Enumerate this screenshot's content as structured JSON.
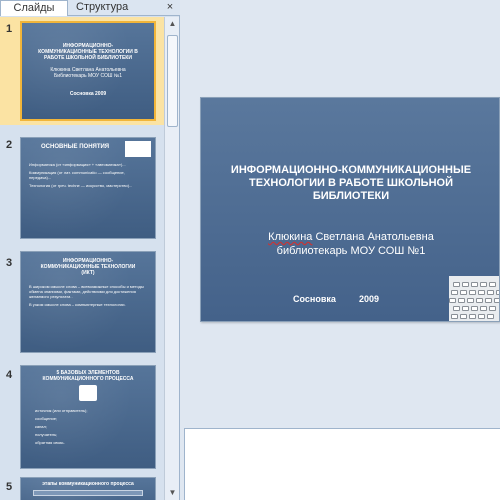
{
  "left_pane": {
    "tabs": {
      "slides": "Слайды",
      "outline": "Структура"
    },
    "close_symbol": "×",
    "thumbnails": [
      {
        "number": "1",
        "title": "ИНФОРМАЦИОННО-КОММУНИКАЦИОННЫЕ ТЕХНОЛОГИИ В РАБОТЕ ШКОЛЬНОЙ БИБЛИОТЕКИ",
        "subtitle": "Клюкина Светлана Анатольевна Библиотекарь МОУ СОШ №1",
        "footer": "Сосновка 2009"
      },
      {
        "number": "2",
        "title": "ОСНОВНЫЕ ПОНЯТИЯ",
        "bullets": [
          "Информатика (от «информация» + «автоматика»)...",
          "Коммуникация (от лат. communicatio — сообщение, передача)...",
          "Технология (от греч. techne — искусство, мастерство)..."
        ]
      },
      {
        "number": "3",
        "title": "ИНФОРМАЦИОННО-КОММУНИКАЦИОННЫЕ ТЕХНОЛОГИИ (ИКТ)",
        "bullets": [
          "В широком смысле слова – всевозможные способы и методы обмена знаниями, фактами, действиями для достижения желаемого результата .",
          "В узком смысле слова – компьютерные технологии."
        ]
      },
      {
        "number": "4",
        "title": "5 БАЗОВЫХ ЭЛЕМЕНТОВ КОММУНИКАЦИОННОГО ПРОЦЕССА",
        "bullets": [
          "источник (или отправитель);",
          "сообщение;",
          "канал;",
          "получатель;",
          "обратная связь."
        ]
      },
      {
        "number": "5",
        "title": "этапы коммуникационного процесса"
      }
    ]
  },
  "main_slide": {
    "title": "ИНФОРМАЦИОННО-КОММУНИКАЦИОННЫЕ ТЕХНОЛОГИИ В РАБОТЕ ШКОЛЬНОЙ БИБЛИОТЕКИ",
    "author_name": "Клюкина",
    "author_rest": " Светлана Анатольевна",
    "position": "библиотекарь МОУ СОШ №1",
    "place": "Сосновка",
    "year": "2009"
  },
  "notes": {
    "text": ""
  }
}
